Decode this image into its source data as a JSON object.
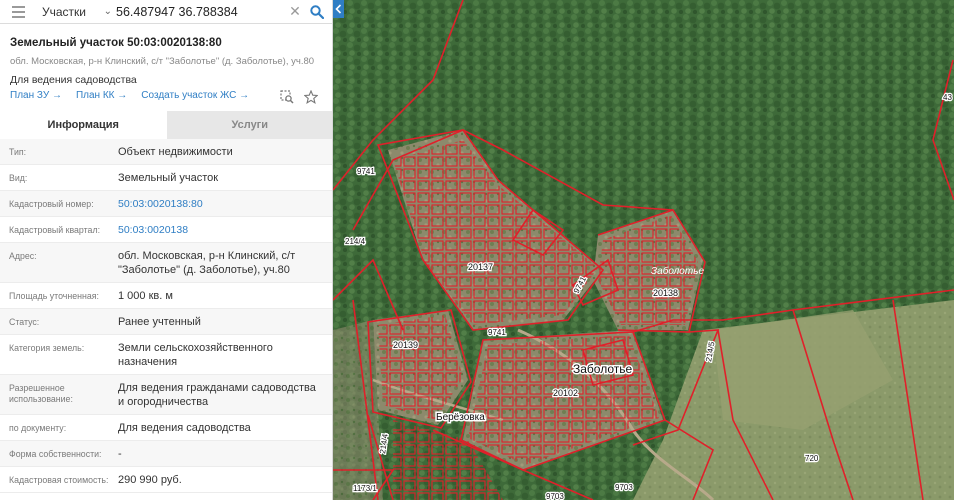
{
  "search": {
    "layer": "Участки",
    "query": "56.487947 36.788384"
  },
  "parcel": {
    "title": "Земельный участок 50:03:0020138:80",
    "address": "обл. Московская, р-н Клинский, с/т \"Заболотье\" (д. Заболотье), уч.80",
    "purpose": "Для ведения садоводства"
  },
  "links": [
    "План ЗУ →",
    "План КК →",
    "Создать участок ЖС →"
  ],
  "tabs": [
    "Информация",
    "Услуги"
  ],
  "info": [
    {
      "k": "Тип:",
      "v": "Объект недвижимости"
    },
    {
      "k": "Вид:",
      "v": "Земельный участок"
    },
    {
      "k": "Кадастровый номер:",
      "v": "50:03:0020138:80"
    },
    {
      "k": "Кадастровый квартал:",
      "v": "50:03:0020138"
    },
    {
      "k": "Адрес:",
      "v": "обл. Московская, р-н Клинский, с/т \"Заболотье\" (д. Заболотье), уч.80"
    },
    {
      "k": "Площадь уточненная:",
      "v": "1 000 кв. м"
    },
    {
      "k": "Статус:",
      "v": "Ранее учтенный"
    },
    {
      "k": "Категория земель:",
      "v": "Земли сельскохозяйственного назначения"
    },
    {
      "k": "Разрешенное использование:",
      "v": "Для ведения гражданами садоводства и огородничества"
    },
    {
      "k": "по документу:",
      "v": "Для ведения садоводства"
    },
    {
      "k": "Форма собственности:",
      "v": "-"
    },
    {
      "k": "Кадастровая стоимость:",
      "v": "290 990 руб."
    }
  ],
  "map_labels": {
    "block_20137": "20137",
    "block_20138": "20138",
    "block_20139": "20139",
    "block_20102": "20102",
    "zabolotye_small": "Заболотье",
    "zabolotye_big": "Заболотье",
    "berezovka": "Берёзовка",
    "n9741_a": "9741",
    "n9741_b": "9741",
    "n2144_a": "214/4",
    "n2144_b": "214/4",
    "n2145": "214/5",
    "n720": "720",
    "n1173": "1173/1",
    "n9703_a": "9703",
    "n9703_b": "9703",
    "n43": "43",
    "n9741_diag": "9741"
  },
  "colors": {
    "accent": "#2f7ec4",
    "boundary": "#e0202a",
    "forest": "#3f6a3a"
  }
}
